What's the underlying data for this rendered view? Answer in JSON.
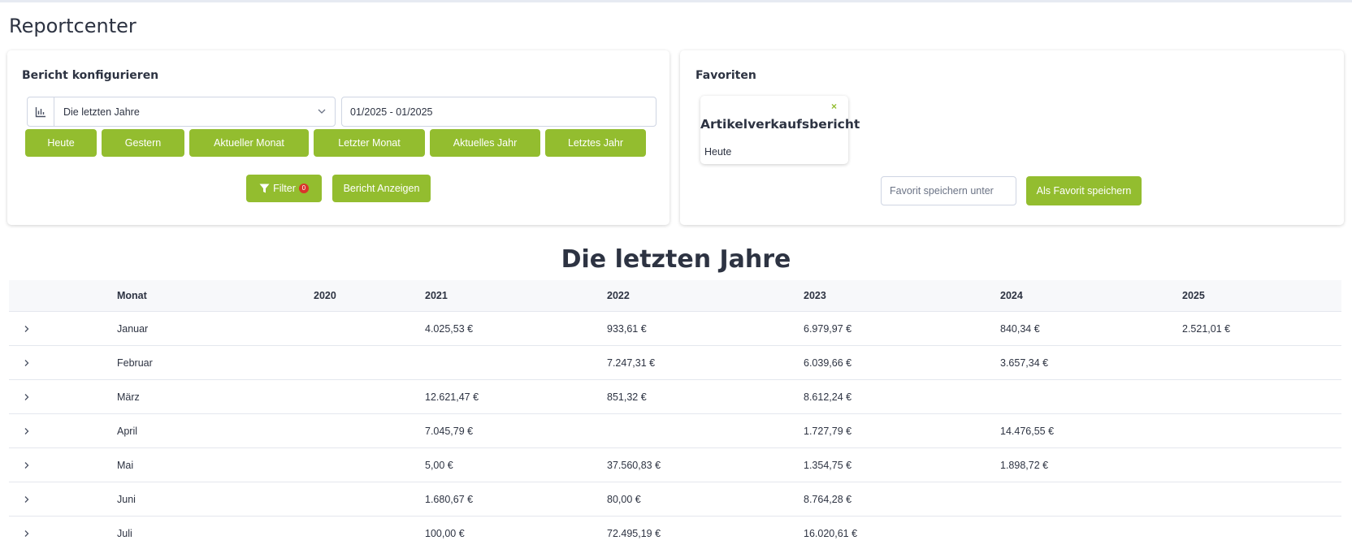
{
  "page": {
    "title": "Reportcenter"
  },
  "config": {
    "title": "Bericht konfigurieren",
    "report_type": "Die letzten Jahre",
    "date_range": "01/2025 - 01/2025",
    "quick_buttons": [
      "Heute",
      "Gestern",
      "Aktueller Monat",
      "Letzter Monat",
      "Aktuelles Jahr",
      "Letztes Jahr"
    ],
    "filter_label": "Filter",
    "filter_count": "0",
    "show_report_label": "Bericht Anzeigen"
  },
  "favorites": {
    "title": "Favoriten",
    "items": [
      {
        "name": "Artikelverkaufsbericht",
        "period": "Heute",
        "remove_icon": "×"
      }
    ],
    "save_placeholder": "Favorit speichern unter",
    "save_button": "Als Favorit speichern"
  },
  "report": {
    "title": "Die letzten Jahre",
    "columns": [
      "Monat",
      "2020",
      "2021",
      "2022",
      "2023",
      "2024",
      "2025"
    ],
    "rows": [
      {
        "month": "Januar",
        "values": [
          "",
          "4.025,53 €",
          "933,61 €",
          "6.979,97 €",
          "840,34 €",
          "2.521,01 €"
        ]
      },
      {
        "month": "Februar",
        "values": [
          "",
          "",
          "7.247,31 €",
          "6.039,66 €",
          "3.657,34 €",
          ""
        ]
      },
      {
        "month": "März",
        "values": [
          "",
          "12.621,47 €",
          "851,32 €",
          "8.612,24 €",
          "",
          ""
        ]
      },
      {
        "month": "April",
        "values": [
          "",
          "7.045,79 €",
          "",
          "1.727,79 €",
          "14.476,55 €",
          ""
        ]
      },
      {
        "month": "Mai",
        "values": [
          "",
          "5,00 €",
          "37.560,83 €",
          "1.354,75 €",
          "1.898,72 €",
          ""
        ]
      },
      {
        "month": "Juni",
        "values": [
          "",
          "1.680,67 €",
          "80,00 €",
          "8.764,28 €",
          "",
          ""
        ]
      },
      {
        "month": "Juli",
        "values": [
          "",
          "100,00 €",
          "72.495,19 €",
          "16.020,61 €",
          "",
          ""
        ]
      }
    ]
  },
  "colors": {
    "accent": "#93bd2f",
    "badge": "#d9342b",
    "text": "#2d3342"
  },
  "icons": {
    "report_type": "bar-chart-icon",
    "select": "chevron-down-icon",
    "filter": "filter-icon",
    "expand": "chevron-right-icon"
  }
}
